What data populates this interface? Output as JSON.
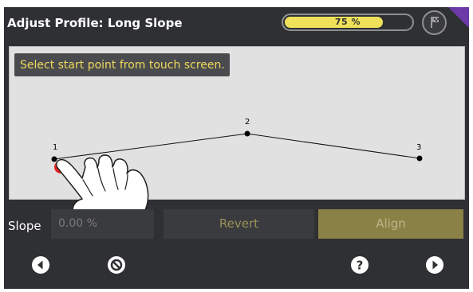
{
  "header": {
    "title": "Adjust Profile: Long Slope",
    "progress": {
      "value": 0.75,
      "label": "75 %"
    }
  },
  "canvas": {
    "instruction": "Select start point from touch screen.",
    "points": [
      {
        "label": "1",
        "active": true
      },
      {
        "label": "2",
        "active": false
      },
      {
        "label": "3",
        "active": false
      }
    ]
  },
  "controls": {
    "slope_label": "Slope",
    "slope_value": "0.00 %",
    "revert_label": "Revert",
    "align_label": "Align"
  },
  "colors": {
    "accent_yellow": "#efe25a",
    "instruction_text": "#eed95c",
    "active_point": "#e3241d",
    "corner_purple": "#6b3aa8"
  },
  "icons": {
    "back": "arrow-left-icon",
    "cancel": "no-entry-icon",
    "help": "question-icon",
    "forward": "arrow-right-icon",
    "flag": "flag-icon"
  }
}
